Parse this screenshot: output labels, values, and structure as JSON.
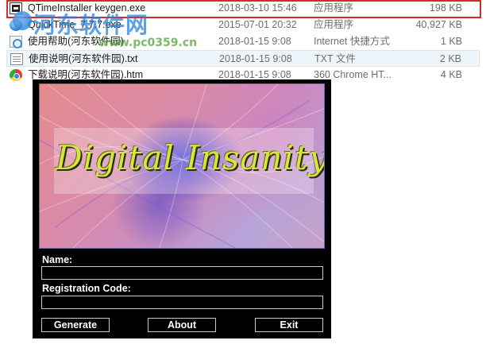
{
  "files": [
    {
      "name": "QTimeInstaller keygen.exe",
      "date": "2018-03-10 15:46",
      "type": "应用程序",
      "size": "198 KB",
      "icon": "exe-icon"
    },
    {
      "name": "QuickTime_7.7.7.exe",
      "date": "2015-07-01 20:32",
      "type": "应用程序",
      "size": "40,927 KB",
      "icon": "quicktime-icon"
    },
    {
      "name": "使用帮助(河东软件园)",
      "date": "2018-01-15 9:08",
      "type": "Internet 快捷方式",
      "size": "1 KB",
      "icon": "internet-shortcut-icon"
    },
    {
      "name": "使用说明(河东软件园).txt",
      "date": "2018-01-15 9:08",
      "type": "TXT 文件",
      "size": "2 KB",
      "icon": "text-file-icon"
    },
    {
      "name": "下载说明(河东软件园).htm",
      "date": "2018-01-15 9:08",
      "type": "360 Chrome HT...",
      "size": "4 KB",
      "icon": "chrome-html-icon"
    }
  ],
  "watermark": {
    "text": "河东软件网",
    "url": "www.pc0359.cn"
  },
  "keygen": {
    "banner_title": "Digital Insanity",
    "name_label": "Name:",
    "name_value": "",
    "regcode_label": "Registration Code:",
    "regcode_value": "",
    "generate_label": "Generate",
    "about_label": "About",
    "exit_label": "Exit"
  },
  "colors": {
    "selection_outline": "#d42a2a",
    "keygen_background": "#000000",
    "banner_title": "#d6e640"
  }
}
